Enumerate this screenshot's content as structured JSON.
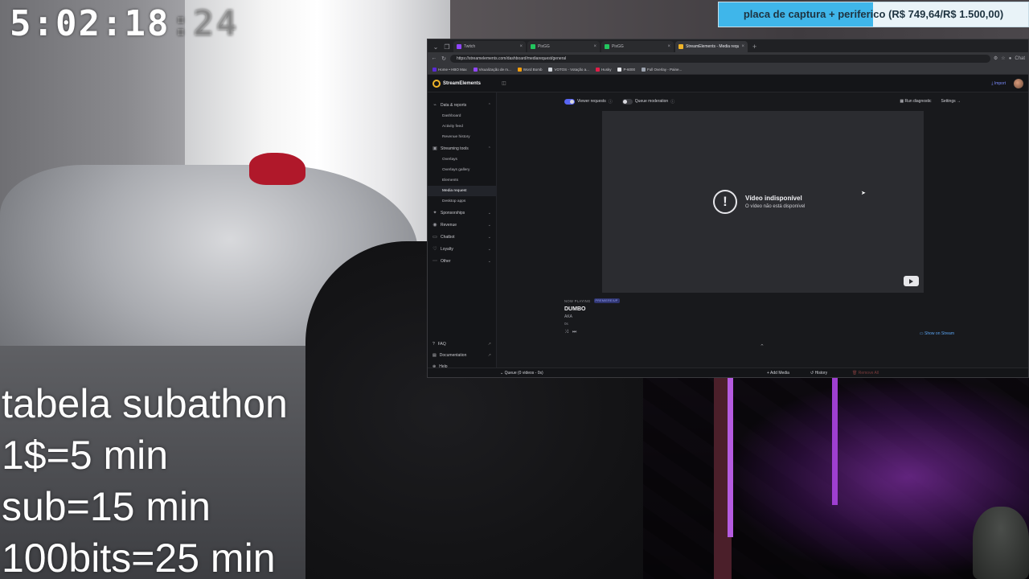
{
  "stream_overlay": {
    "timer_main": "5:02:18",
    "timer_faded": ":24",
    "goal_text": "placa de captura + periferico (R$ 749,64/R$ 1.500,00)",
    "goal_progress": 0.4998,
    "goal_color": "#3fb6ea",
    "subathon_lines": [
      "tabela subathon",
      "1$=5 min",
      "sub=15 min",
      "100bits=25 min"
    ]
  },
  "browser": {
    "tabs": [
      {
        "label": "Twitch",
        "color": "#9146ff",
        "active": false
      },
      {
        "label": "PixGG",
        "color": "#22c55e",
        "active": false
      },
      {
        "label": "PixGG",
        "color": "#22c55e",
        "active": false
      },
      {
        "label": "StreamElements - Media request",
        "color": "#f0b429",
        "active": true
      }
    ],
    "url": "https://streamelements.com/dashboard/mediarequest/general",
    "bookmarks": [
      {
        "label": "Home • HBO Max",
        "color": "#5b2bd6"
      },
      {
        "label": "Visualização de m...",
        "color": "#9146ff"
      },
      {
        "label": "Word Bomb",
        "color": "#f59e0b"
      },
      {
        "label": "VOTOS - Votação a...",
        "color": "#d1d5db"
      },
      {
        "label": "Husky",
        "color": "#e11d48"
      },
      {
        "label": "P-6000",
        "color": "#e5e7eb"
      },
      {
        "label": "Full Overlay - Paine...",
        "color": "#9ca3af"
      }
    ],
    "chat_label": "Chat"
  },
  "app": {
    "brand": "StreamElements",
    "import_label": "Import",
    "sidebar": {
      "groups": [
        {
          "label": "Data & reports",
          "icon": "chart-icon",
          "expanded": true,
          "items": [
            "Dashboard",
            "Activity feed",
            "Revenue history"
          ]
        },
        {
          "label": "Streaming tools",
          "icon": "tools-icon",
          "expanded": true,
          "items": [
            "Overlays",
            "Overlays gallery",
            "Elements",
            "Media request",
            "Desktop apps"
          ]
        },
        {
          "label": "Sponsorships",
          "icon": "star-icon",
          "expanded": false,
          "items": []
        },
        {
          "label": "Revenue",
          "icon": "dollar-icon",
          "expanded": false,
          "items": []
        },
        {
          "label": "Chatbot",
          "icon": "chat-icon",
          "expanded": false,
          "items": []
        },
        {
          "label": "Loyalty",
          "icon": "heart-icon",
          "expanded": false,
          "items": []
        },
        {
          "label": "Other",
          "icon": "more-icon",
          "expanded": false,
          "items": []
        }
      ],
      "active_item": "Media request",
      "bottom_links": [
        "FAQ",
        "Documentation",
        "Help"
      ]
    },
    "controls": {
      "viewer_requests": "Viewer requests",
      "viewer_requests_on": true,
      "queue_moderation": "Queue moderation",
      "queue_moderation_on": false,
      "run_diagnostic": "Run diagnostic",
      "settings": "Settings"
    },
    "player": {
      "error_title": "Vídeo indisponível",
      "error_subtitle": "O vídeo não está disponível"
    },
    "now_playing": {
      "label": "NOW PLAYING",
      "badge": "PREMIERE/UP",
      "title": "DUMBO",
      "by": "AKA",
      "duration": "0s"
    },
    "show_on_stream": "Show on Stream",
    "footer": {
      "queue": "Queue (0 videos - 0s)",
      "add_media": "Add Media",
      "history": "History",
      "remove_all": "Remove All"
    }
  }
}
